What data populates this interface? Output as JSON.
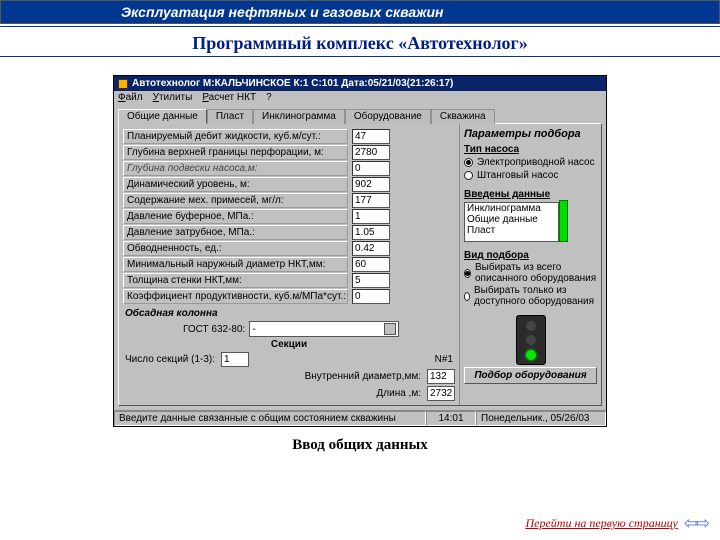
{
  "header": {
    "category": "Эксплуатация нефтяных и газовых скважин",
    "title": "Программный комплекс «Автотехнолог»"
  },
  "app": {
    "titlebar": "Автотехнолог  М:КАЛЬЧИНСКОЕ  К:1  С:101  Дата:05/21/03(21:26:17)",
    "menus": {
      "file": "Файл",
      "util": "Утилиты",
      "calc": "Расчет НКТ",
      "help": "?"
    },
    "tabs": {
      "t1": "Общие данные",
      "t2": "Пласт",
      "t3": "Инклинограмма",
      "t4": "Оборудование",
      "t5": "Скважина"
    },
    "fields": {
      "debit_label": "Планируемый дебит жидкости, куб.м/сут.:",
      "debit": "47",
      "perf_label": "Глубина верхней границы перфорации, м:",
      "perf": "2780",
      "hangdepth_label": "Глубина подвески насоса,м:",
      "hangdepth": "0",
      "dynlvl_label": "Динамический уровень, м:",
      "dynlvl": "902",
      "solids_label": "Содержание мех. примесей, мг/л:",
      "solids": "177",
      "pbuff_label": "Давление буферное, МПа.:",
      "pbuff": "1",
      "pann_label": "Давление затрубное, МПа.:",
      "pann": "1.05",
      "water_label": "Обводненность, ед.:",
      "water": "0.42",
      "nkt_od_label": "Минимальный наружный диаметр НКТ,мм:",
      "nkt_od": "60",
      "nkt_wt_label": "Толщина стенки НКТ,мм:",
      "nkt_wt": "5",
      "prod_label": "Коэффициент продуктивности, куб.м/МПа*сут.:",
      "prod": "0"
    },
    "casing": {
      "heading": "Обсадная колонна",
      "gost_label": "ГОСТ 632-80:",
      "gost_value": "-",
      "sections_heading": "Секции",
      "col_n": "N#1",
      "nsec_label": "Число секций (1-3):",
      "nsec": "1",
      "id_label": "Внутренний диаметр,мм:",
      "id_val": "132",
      "len_label": "Длина ,м:",
      "len_val": "2732"
    },
    "right": {
      "heading": "Параметры подбора",
      "pump_heading": "Тип насоса",
      "pump1": "Электроприводной насос",
      "pump2": "Штанговый насос",
      "data_heading": "Введены данные",
      "list": {
        "a": "Инклинограмма",
        "b": "Общие данные",
        "c": "Пласт"
      },
      "pick_heading": "Вид подбора",
      "pick1": "Выбирать из всего описанного оборудования",
      "pick2": "Выбирать только из доступного оборудования",
      "pick_button": "Подбор оборудования"
    },
    "status": {
      "msg": "Введите данные связанные с общим состоянием скважины",
      "time": "14:01",
      "date": "Понедельник., 05/26/03"
    }
  },
  "caption": "Ввод общих данных",
  "footer": {
    "link": "Перейти на первую страницу"
  }
}
